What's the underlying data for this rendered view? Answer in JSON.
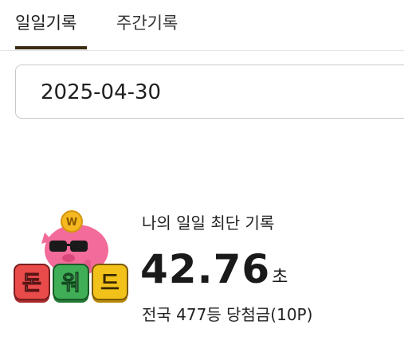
{
  "tabs": [
    {
      "label": "일일기록",
      "active": true
    },
    {
      "label": "주간기록",
      "active": false
    }
  ],
  "date_selector": {
    "value": "2025-04-30"
  },
  "record": {
    "label": "나의 일일 최단 기록",
    "time_value": "42.76",
    "time_unit": "초",
    "rank_prize": "전국 477등 당첨금(10P)"
  },
  "logo": {
    "tiles": [
      "돈",
      "워",
      "드"
    ],
    "coin_symbol": "W",
    "icon": "pig-mascot-icon"
  },
  "colors": {
    "tab_indicator": "#3b2a10",
    "tile_red": "#e94b4b",
    "tile_green": "#3fae57",
    "tile_yellow": "#f2c21b",
    "pig_pink": "#f26b9a",
    "coin_gold": "#f5b820"
  }
}
